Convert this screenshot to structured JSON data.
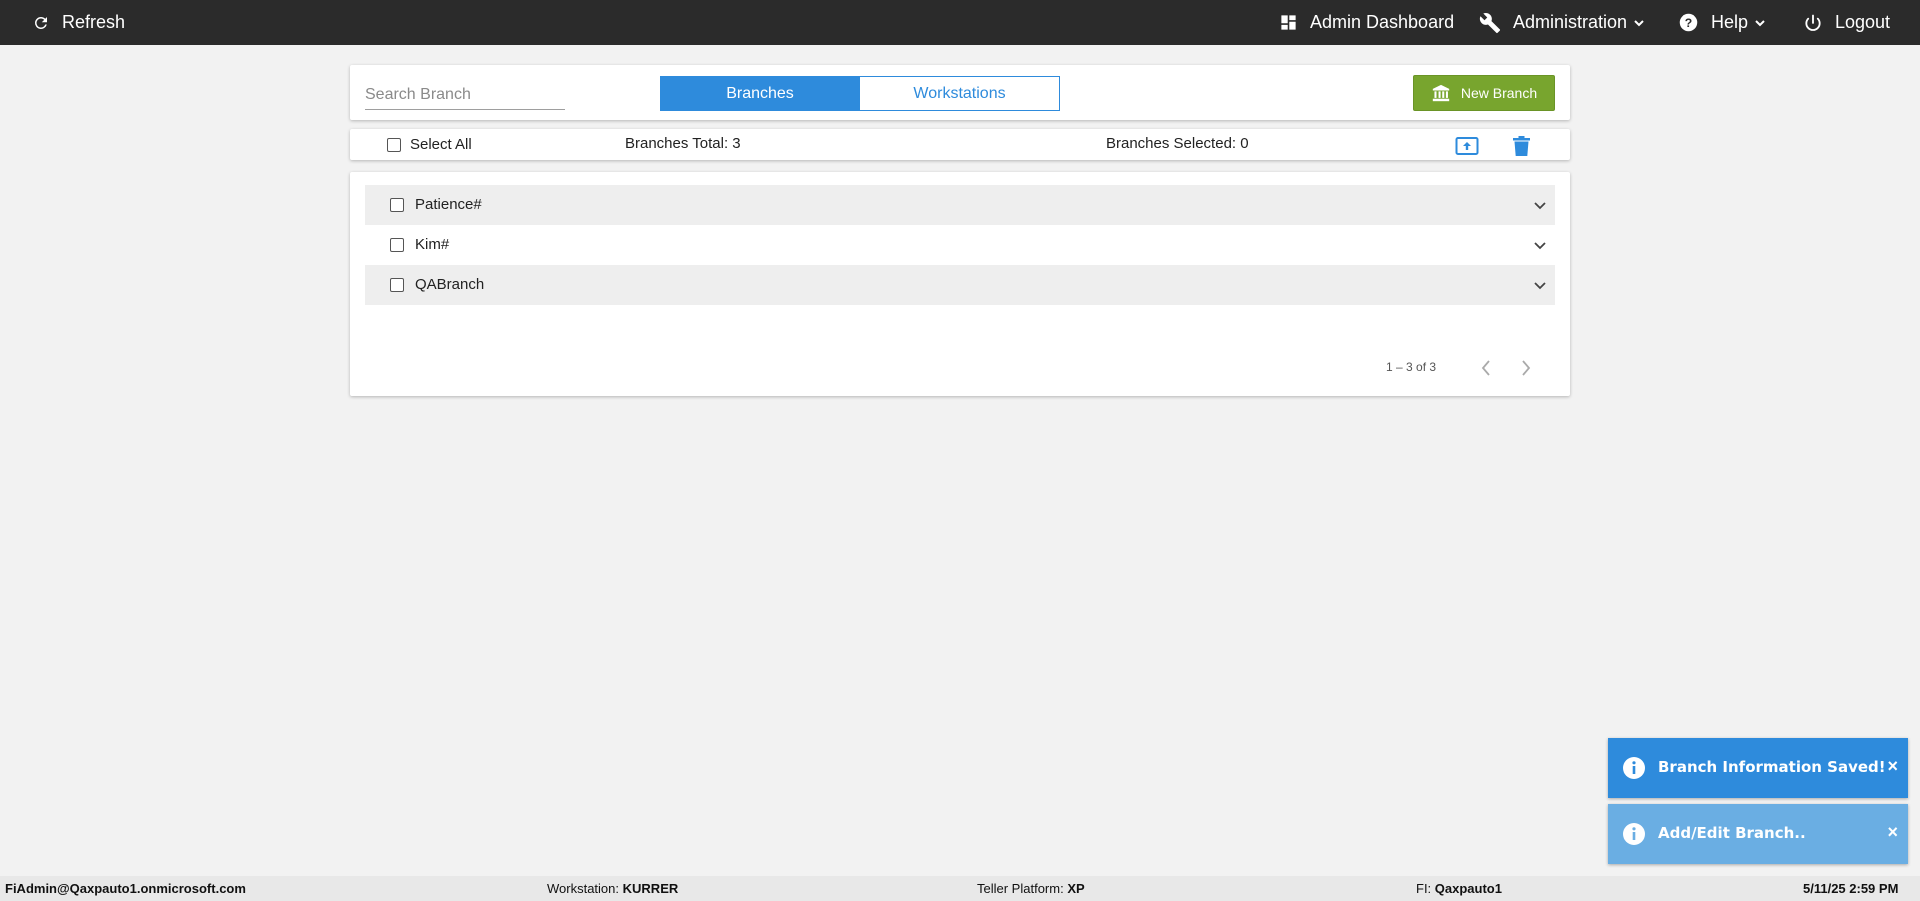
{
  "topbar": {
    "refresh_label": "Refresh",
    "admin_dashboard_label": "Admin Dashboard",
    "administration_label": "Administration",
    "help_label": "Help",
    "logout_label": "Logout",
    "background": "#2b2b2b"
  },
  "search": {
    "placeholder": "Search Branch",
    "value": ""
  },
  "tabs": [
    {
      "label": "Branches",
      "active": true
    },
    {
      "label": "Workstations",
      "active": false
    }
  ],
  "new_branch": {
    "label": "New Branch",
    "color": "#78a52e"
  },
  "selection_bar": {
    "select_all_label": "Select All",
    "total_label": "Branches Total: 3",
    "selected_label": "Branches Selected: 0",
    "export_icon": "upload-box-icon",
    "delete_icon": "trash-icon"
  },
  "branches": [
    {
      "name": "Patience#",
      "checked": false
    },
    {
      "name": "Kim#",
      "checked": false
    },
    {
      "name": "QABranch",
      "checked": false
    }
  ],
  "pagination": {
    "range_label": "1 – 3 of 3"
  },
  "toasts": [
    {
      "message": "Branch Information Saved!",
      "color": "#2e8bdc"
    },
    {
      "message": "Add/Edit Branch..",
      "color": "#6aaee3"
    }
  ],
  "status_bar": {
    "user": "FiAdmin@Qaxpauto1.onmicrosoft.com",
    "workstation_label": "Workstation:",
    "workstation_value": "KURRER",
    "platform_label": "Teller Platform:",
    "platform_value": "XP",
    "fi_label": "FI:",
    "fi_value": "Qaxpauto1",
    "datetime": "5/11/25 2:59 PM"
  },
  "accent_color": "#2e8bdc"
}
